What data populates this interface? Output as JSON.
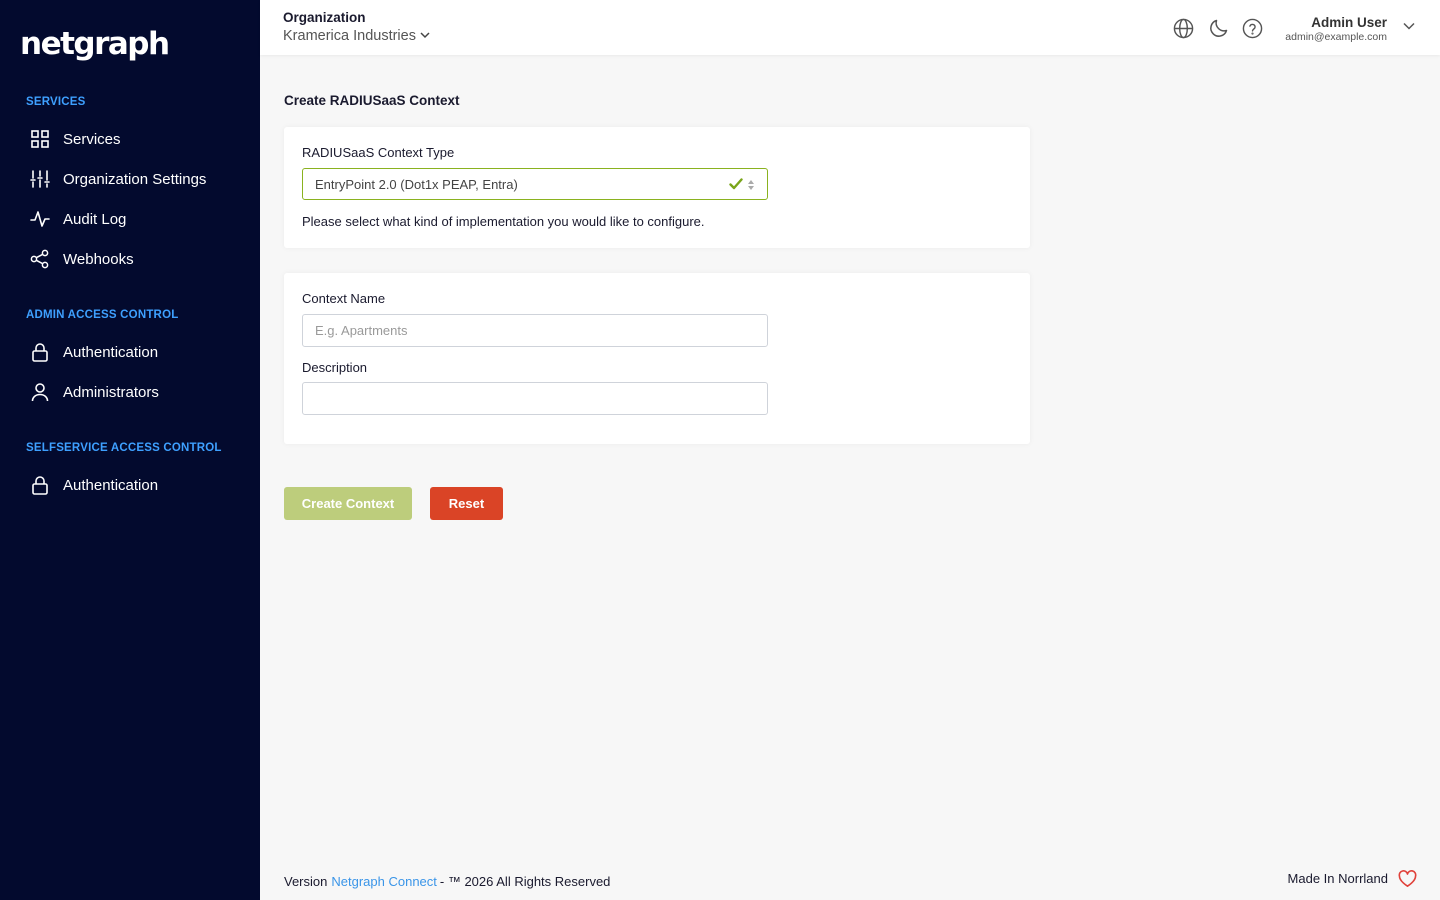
{
  "brand": {
    "logo_text": "netgraph"
  },
  "sidebar": {
    "sections": [
      {
        "title": "SERVICES",
        "items": [
          {
            "label": "Services",
            "icon": "grid-icon"
          },
          {
            "label": "Organization Settings",
            "icon": "sliders-icon"
          },
          {
            "label": "Audit Log",
            "icon": "activity-icon"
          },
          {
            "label": "Webhooks",
            "icon": "share-icon"
          }
        ]
      },
      {
        "title": "ADMIN ACCESS CONTROL",
        "items": [
          {
            "label": "Authentication",
            "icon": "lock-icon"
          },
          {
            "label": "Administrators",
            "icon": "user-icon"
          }
        ]
      },
      {
        "title": "SELFSERVICE ACCESS CONTROL",
        "items": [
          {
            "label": "Authentication",
            "icon": "lock-icon"
          }
        ]
      }
    ]
  },
  "header": {
    "org_label": "Organization",
    "org_value": "Kramerica Industries",
    "user_name": "Admin User",
    "user_email": "admin@example.com",
    "icons": [
      "globe-icon",
      "moon-icon",
      "help-circle-icon"
    ]
  },
  "main": {
    "title": "Create RADIUSaaS Context",
    "context_type": {
      "label": "RADIUSaaS Context Type",
      "value": "EntryPoint 2.0 (Dot1x PEAP, Entra)",
      "help": "Please select what kind of implementation you would like to configure."
    },
    "context_name": {
      "label": "Context Name",
      "placeholder": "E.g. Apartments",
      "value": ""
    },
    "description": {
      "label": "Description",
      "value": ""
    },
    "buttons": {
      "create": "Create Context",
      "reset": "Reset"
    }
  },
  "footer": {
    "version_prefix": "Version",
    "link_text": "Netgraph Connect",
    "suffix": "- ™ 2026 All Rights Reserved",
    "made_in": "Made In Norrland"
  },
  "colors": {
    "sidebar_bg": "#030a2e",
    "section_title": "#3ea0ff",
    "valid_border": "#8ab21f",
    "create_button": "#bdcd7c",
    "reset_button": "#da4426",
    "link": "#3a95e8",
    "heart": "#e0413a"
  }
}
